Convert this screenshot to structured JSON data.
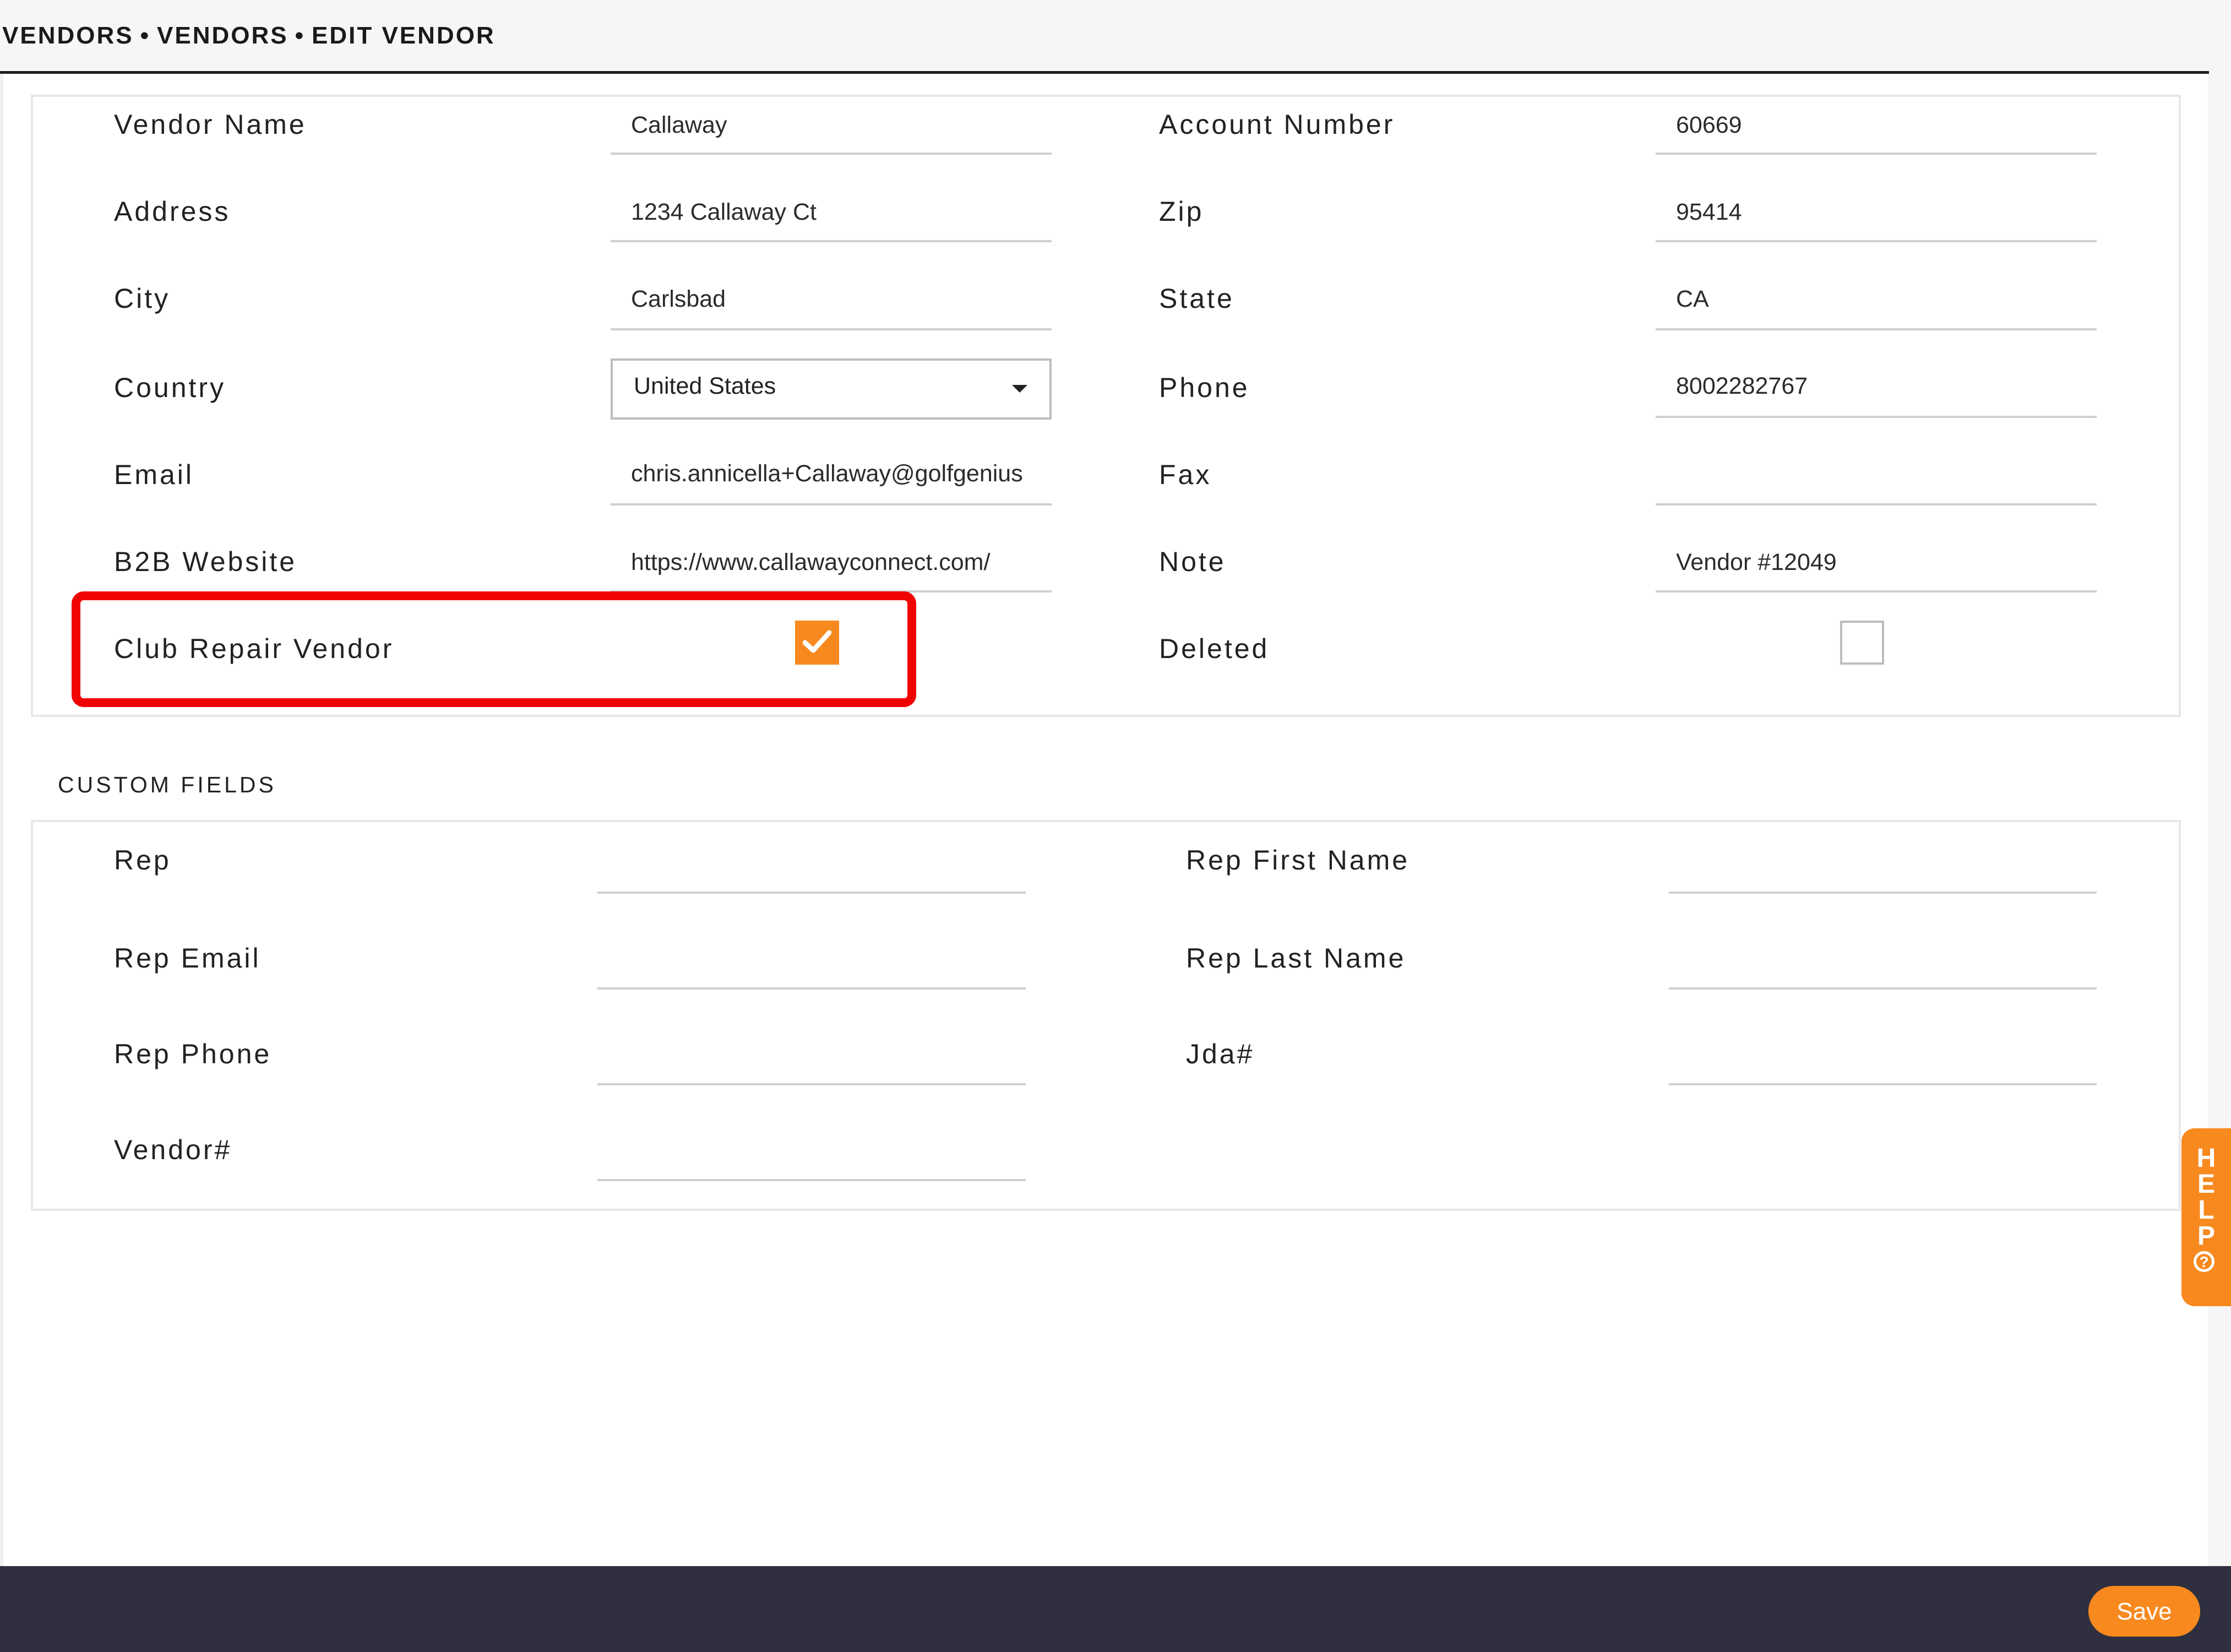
{
  "breadcrumb": [
    "VENDORS",
    "VENDORS",
    "EDIT VENDOR"
  ],
  "breadcrumb_separator": "•",
  "form": {
    "vendor_name": {
      "label": "Vendor Name",
      "value": "Callaway"
    },
    "account_number": {
      "label": "Account Number",
      "value": "60669"
    },
    "address": {
      "label": "Address",
      "value": "1234 Callaway Ct"
    },
    "zip": {
      "label": "Zip",
      "value": "95414"
    },
    "city": {
      "label": "City",
      "value": "Carlsbad"
    },
    "state": {
      "label": "State",
      "value": "CA"
    },
    "country": {
      "label": "Country",
      "value": "United States"
    },
    "phone": {
      "label": "Phone",
      "value": "8002282767"
    },
    "email": {
      "label": "Email",
      "value": "chris.annicella+Callaway@golfgenius"
    },
    "fax": {
      "label": "Fax",
      "value": ""
    },
    "b2b_website": {
      "label": "B2B Website",
      "value": "https://www.callawayconnect.com/"
    },
    "note": {
      "label": "Note",
      "value": "Vendor #12049"
    },
    "club_repair_vendor": {
      "label": "Club Repair Vendor",
      "checked": true
    },
    "deleted": {
      "label": "Deleted",
      "checked": false
    }
  },
  "custom_fields": {
    "title": "CUSTOM FIELDS",
    "rep": {
      "label": "Rep",
      "value": ""
    },
    "rep_first_name": {
      "label": "Rep First Name",
      "value": ""
    },
    "rep_email": {
      "label": "Rep Email",
      "value": ""
    },
    "rep_last_name": {
      "label": "Rep Last Name",
      "value": ""
    },
    "rep_phone": {
      "label": "Rep Phone",
      "value": ""
    },
    "jda": {
      "label": "Jda#",
      "value": ""
    },
    "vendor_no": {
      "label": "Vendor#",
      "value": ""
    }
  },
  "help": {
    "letters": [
      "H",
      "E",
      "L",
      "P"
    ],
    "icon": "question-circle-icon",
    "glyph": "?"
  },
  "footer": {
    "save_label": "Save"
  },
  "colors": {
    "accent": "#f7891f",
    "highlight": "#f00303",
    "footer_bg": "#2f2f3f"
  }
}
